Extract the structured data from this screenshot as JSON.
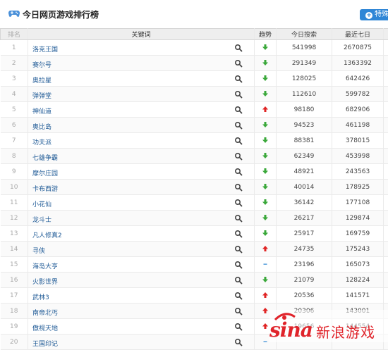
{
  "header": {
    "title": "今日网页游戏排行榜",
    "more_label": "特殊"
  },
  "columns": {
    "rank": "排名",
    "keyword": "关键词",
    "trend": "趋势",
    "today": "今日搜索",
    "week": "最近七日"
  },
  "rows": [
    {
      "rank": "1",
      "keyword": "洛克王国",
      "trend": "down",
      "today": "541998",
      "week": "2670875"
    },
    {
      "rank": "2",
      "keyword": "赛尔号",
      "trend": "down",
      "today": "291349",
      "week": "1363392"
    },
    {
      "rank": "3",
      "keyword": "奥拉星",
      "trend": "down",
      "today": "128025",
      "week": "642426"
    },
    {
      "rank": "4",
      "keyword": "弹弹堂",
      "trend": "down",
      "today": "112610",
      "week": "599782"
    },
    {
      "rank": "5",
      "keyword": "神仙道",
      "trend": "up",
      "today": "98180",
      "week": "682906"
    },
    {
      "rank": "6",
      "keyword": "奥比岛",
      "trend": "down",
      "today": "94523",
      "week": "461198"
    },
    {
      "rank": "7",
      "keyword": "功夫派",
      "trend": "down",
      "today": "88381",
      "week": "378015"
    },
    {
      "rank": "8",
      "keyword": "七雄争霸",
      "trend": "down",
      "today": "62349",
      "week": "453998"
    },
    {
      "rank": "9",
      "keyword": "摩尔庄园",
      "trend": "down",
      "today": "48921",
      "week": "243563"
    },
    {
      "rank": "10",
      "keyword": "卡布西游",
      "trend": "down",
      "today": "40014",
      "week": "178925"
    },
    {
      "rank": "11",
      "keyword": "小花仙",
      "trend": "down",
      "today": "36142",
      "week": "177108"
    },
    {
      "rank": "12",
      "keyword": "龙斗士",
      "trend": "down",
      "today": "26217",
      "week": "129874"
    },
    {
      "rank": "13",
      "keyword": "凡人修真2",
      "trend": "down",
      "today": "25917",
      "week": "169759"
    },
    {
      "rank": "14",
      "keyword": "寻侠",
      "trend": "up",
      "today": "24735",
      "week": "175243"
    },
    {
      "rank": "15",
      "keyword": "海岛大亨",
      "trend": "flat",
      "today": "23196",
      "week": "165073"
    },
    {
      "rank": "16",
      "keyword": "火影世界",
      "trend": "down",
      "today": "21079",
      "week": "128224"
    },
    {
      "rank": "17",
      "keyword": "武林3",
      "trend": "up",
      "today": "20536",
      "week": "141571"
    },
    {
      "rank": "18",
      "keyword": "南帝北丐",
      "trend": "up",
      "today": "20306",
      "week": "143001"
    },
    {
      "rank": "19",
      "keyword": "傲视天地",
      "trend": "up",
      "today": "19656",
      "week": "144554"
    },
    {
      "rank": "20",
      "keyword": "王国印记",
      "trend": "flat",
      "today": "",
      "week": ""
    }
  ],
  "watermark": {
    "brand": "sina",
    "name": "新浪游戏"
  },
  "colors": {
    "up": "#e02424",
    "down": "#3aa83a",
    "flat": "#3a8fd6",
    "link": "#1f5a96",
    "accent": "#2f86d6"
  },
  "icons": {
    "header": "gamepad-icon",
    "more": "plus-icon",
    "row_action": "search-icon",
    "trend_up": "arrow-up-icon",
    "trend_down": "arrow-down-icon",
    "trend_flat": "dash-icon"
  }
}
